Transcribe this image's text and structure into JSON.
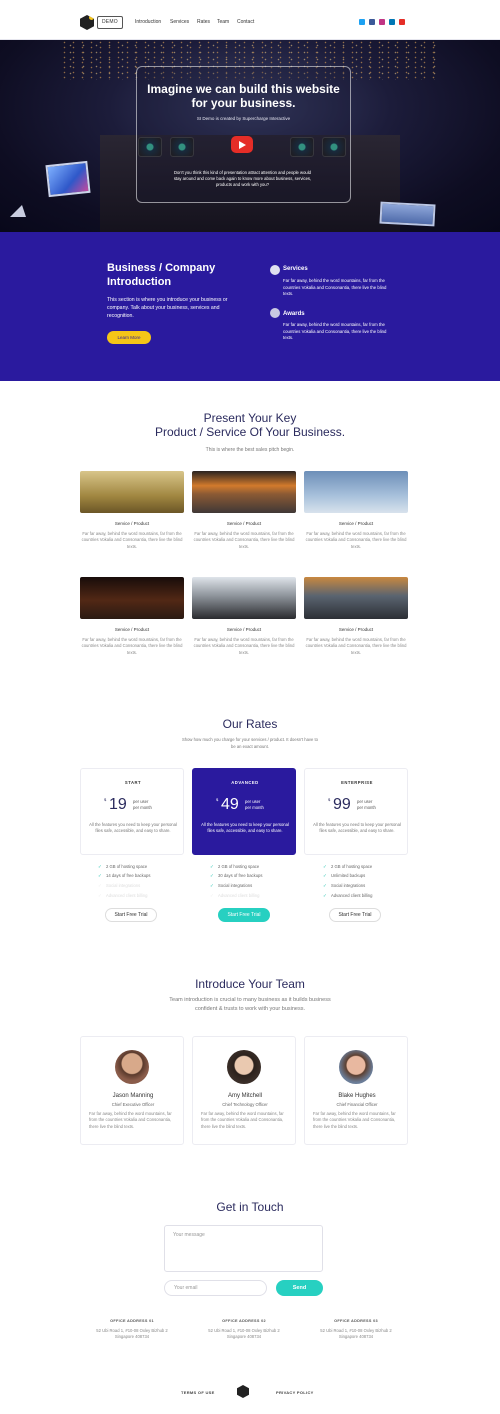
{
  "header": {
    "logo_badge": "DEMO",
    "logo_mark": "SI",
    "nav": [
      "Introduction",
      "Services",
      "Rates",
      "Team",
      "Contact"
    ],
    "social_icons": [
      {
        "name": "twitter-icon",
        "color": "#1da1f2"
      },
      {
        "name": "facebook-icon",
        "color": "#3b5998"
      },
      {
        "name": "instagram-icon",
        "color": "#c13584"
      },
      {
        "name": "linkedin-icon",
        "color": "#0077b5"
      },
      {
        "name": "youtube-icon",
        "color": "#e52d27"
      }
    ]
  },
  "hero": {
    "title": "Imagine we can build this website for your business.",
    "subtitle": "SI Demo is created by Supercharge Interactive",
    "body": "Don't you think this kind of presentation attract attention and people would stay around and come back again to know more about business, services, products and work with you?"
  },
  "about": {
    "title": "Business / Company Introduction",
    "body": "This section is where you introduce your business or company. Talk about your business, services and recognition.",
    "cta": "Learn More",
    "items": [
      {
        "icon": "handshake-icon",
        "heading": "Services",
        "text": "Far far away, behind the word mountains, far from the countries Vokalia and Consonantia, there live the blind texts."
      },
      {
        "icon": "medal-icon",
        "heading": "Awards",
        "text": "Far far away, behind the word mountains, far from the countries Vokalia and Consonantia, there live the blind texts."
      }
    ]
  },
  "services": {
    "title_line1": "Present Your Key",
    "title_line2": "Product / Service Of Your Business.",
    "subtitle": "This is where the best sales pitch begin.",
    "items": [
      {
        "label": "Service / Product",
        "text": "Far far away, behind the word mountains, far from the countries Vokalia and Consonantia, there live the blind texts."
      },
      {
        "label": "Service / Product",
        "text": "Far far away, behind the word mountains, far from the countries Vokalia and Consonantia, there live the blind texts."
      },
      {
        "label": "Service / Product",
        "text": "Far far away, behind the word mountains, far from the countries Vokalia and Consonantia, there live the blind texts."
      },
      {
        "label": "Service / Product",
        "text": "Far far away, behind the word mountains, far from the countries Vokalia and Consonantia, there live the blind texts."
      },
      {
        "label": "Service / Product",
        "text": "Far far away, behind the word mountains, far from the countries Vokalia and Consonantia, there live the blind texts."
      },
      {
        "label": "Service / Product",
        "text": "Far far away, behind the word mountains, far from the countries Vokalia and Consonantia, there live the blind texts."
      }
    ]
  },
  "rates": {
    "title": "Our Rates",
    "subtitle": "Show how much you charge for your services / product. It doesn't have to be an exact amount.",
    "currency": "$",
    "period_line1": "per user",
    "period_line2": "per month",
    "plans": [
      {
        "tier": "START",
        "price": "19",
        "desc": "All the features you need to keep your personal files safe, accessible, and easy to share.",
        "cta": "Start Free Trial",
        "features": [
          {
            "text": "2 GB of hosting space",
            "on": true
          },
          {
            "text": "14 days of free backups",
            "on": true
          },
          {
            "text": "Social integrations",
            "on": false
          },
          {
            "text": "Advanced client billing",
            "on": false
          }
        ]
      },
      {
        "tier": "ADVANCED",
        "price": "49",
        "desc": "All the features you need to keep your personal files safe, accessible, and easy to share.",
        "cta": "Start Free Trial",
        "features": [
          {
            "text": "2 GB of hosting space",
            "on": true
          },
          {
            "text": "30 days of free backups",
            "on": true
          },
          {
            "text": "Social integrations",
            "on": true
          },
          {
            "text": "Advanced client billing",
            "on": false
          }
        ]
      },
      {
        "tier": "ENTERPRISE",
        "price": "99",
        "desc": "All the features you need to keep your personal files safe, accessible, and easy to share.",
        "cta": "Start Free Trial",
        "features": [
          {
            "text": "2 GB of hosting space",
            "on": true
          },
          {
            "text": "Unlimited backups",
            "on": true
          },
          {
            "text": "Social integrations",
            "on": true
          },
          {
            "text": "Advanced client billing",
            "on": true
          }
        ]
      }
    ]
  },
  "team": {
    "title": "Introduce Your Team",
    "subtitle_line1": "Team introduction is crucial to many business as it builds business",
    "subtitle_line2": "confident & trusts to work with your business.",
    "members": [
      {
        "name": "Jason Manning",
        "role": "Chief Executive Officer",
        "text": "Far far away, behind the word mountains, far from the countries Vokalia and Consonantia, there live the blind texts."
      },
      {
        "name": "Amy Mitchell",
        "role": "Chief Technology Officer",
        "text": "Far far away, behind the word mountains, far from the countries Vokalia and Consonantia, there live the blind texts."
      },
      {
        "name": "Blake Hughes",
        "role": "Chief Financial Officer",
        "text": "Far far away, behind the word mountains, far from the countries Vokalia and Consonantia, there live the blind texts."
      }
    ]
  },
  "contact": {
    "title": "Get in Touch",
    "message_placeholder": "Your message",
    "email_placeholder": "Your email",
    "send": "Send",
    "offices": [
      {
        "title": "OFFICE ADDRESS 01",
        "line1": "52 Ubi Road 1, #10-08 Oxley Bizhub 2",
        "line2": "Singapore 408734"
      },
      {
        "title": "OFFICE ADDRESS 02",
        "line1": "52 Ubi Road 1, #10-08 Oxley Bizhub 2",
        "line2": "Singapore 408734"
      },
      {
        "title": "OFFICE ADDRESS 03",
        "line1": "52 Ubi Road 1, #10-08 Oxley Bizhub 2",
        "line2": "Singapore 408734"
      }
    ]
  },
  "footer": {
    "terms": "TERMS OF USE",
    "privacy": "PRIVACY POLICY",
    "logo_mark": "SI"
  },
  "colors": {
    "brand_purple": "#2a1a9e",
    "accent_yellow": "#f5c518",
    "accent_teal": "#27d0c1",
    "heading_navy": "#2b2b5e"
  }
}
